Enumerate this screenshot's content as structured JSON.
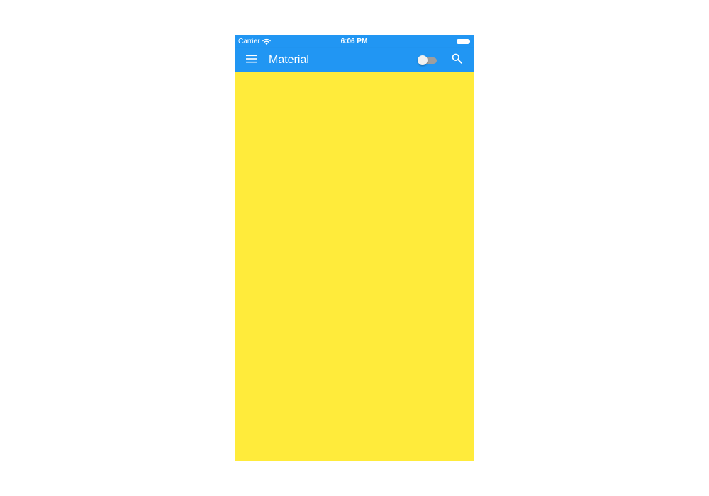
{
  "status_bar": {
    "carrier": "Carrier",
    "time": "6:06 PM",
    "wifi_icon": "wifi-icon",
    "battery_icon": "battery-icon"
  },
  "app_bar": {
    "title": "Material",
    "menu_icon": "menu-icon",
    "toggle_state": "off",
    "search_icon": "search-icon"
  },
  "colors": {
    "primary": "#2196F3",
    "content_background": "#FFEB3B",
    "on_primary": "#FFFFFF"
  }
}
